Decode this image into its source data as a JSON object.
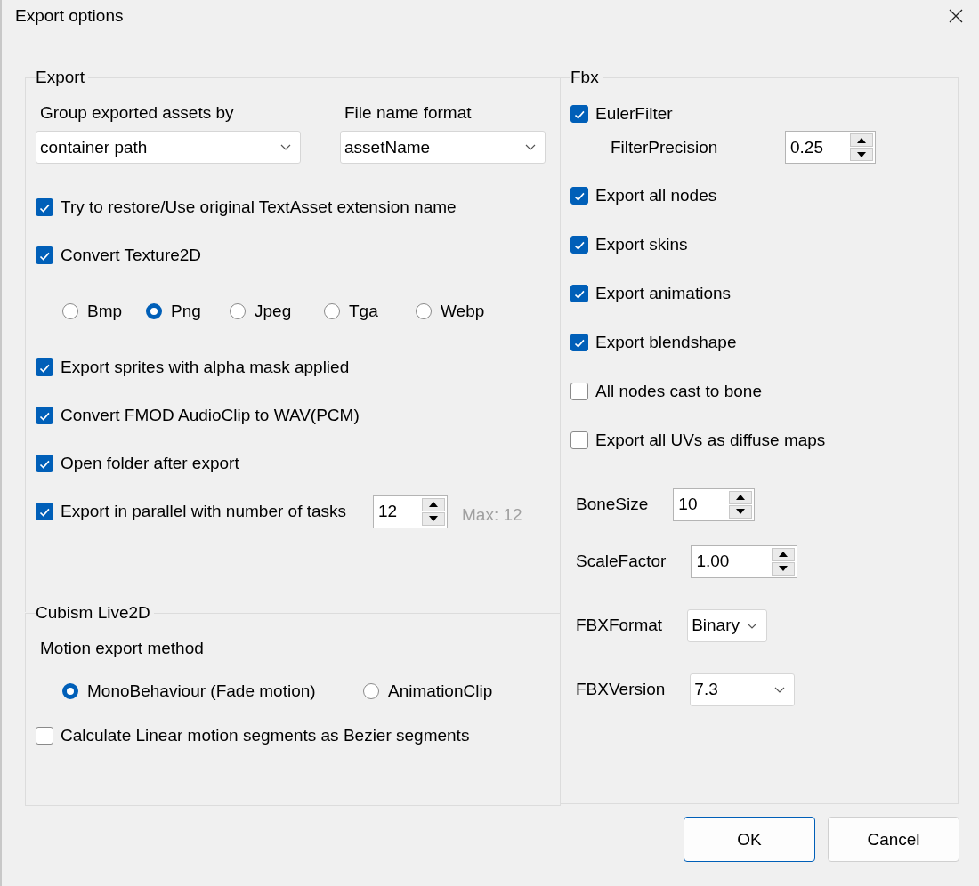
{
  "window": {
    "title": "Export options"
  },
  "export": {
    "title": "Export",
    "group_by": {
      "label": "Group exported assets by",
      "value": "container path"
    },
    "file_name_format": {
      "label": "File name format",
      "value": "assetName"
    },
    "options": [
      {
        "kind": "checkbox",
        "label": "Try to restore/Use original TextAsset extension name",
        "checked": true
      },
      {
        "kind": "checkbox",
        "label": "Convert Texture2D",
        "checked": true
      },
      {
        "kind": "radios",
        "choices": [
          {
            "label": "Bmp",
            "selected": false
          },
          {
            "label": "Png",
            "selected": true
          },
          {
            "label": "Jpeg",
            "selected": false
          },
          {
            "label": "Tga",
            "selected": false
          },
          {
            "label": "Webp",
            "selected": false
          }
        ]
      },
      {
        "kind": "checkbox",
        "label": "Export sprites with alpha mask applied",
        "checked": true
      },
      {
        "kind": "checkbox",
        "label": "Convert FMOD AudioClip to WAV(PCM)",
        "checked": true
      },
      {
        "kind": "checkbox",
        "label": "Open folder after export",
        "checked": true
      },
      {
        "kind": "spin_checkbox",
        "label": "Export in parallel with number of tasks",
        "checked": true,
        "value": "12",
        "note": "Max: 12"
      }
    ]
  },
  "cubism": {
    "title": "Cubism Live2D",
    "motion_label": "Motion export method",
    "motion_methods": [
      {
        "label": "MonoBehaviour (Fade motion)",
        "selected": true
      },
      {
        "label": "AnimationClip",
        "selected": false
      }
    ],
    "options": [
      {
        "label": "Calculate Linear motion segments as Bezier segments",
        "checked": false
      }
    ]
  },
  "fbx": {
    "title": "Fbx",
    "items": [
      {
        "kind": "checkbox",
        "label": "EulerFilter",
        "checked": true,
        "children": [
          {
            "kind": "spin",
            "label": "FilterPrecision",
            "value": "0.25"
          }
        ]
      },
      {
        "kind": "checkbox",
        "label": "Export all nodes",
        "checked": true
      },
      {
        "kind": "checkbox",
        "label": "Export skins",
        "checked": true
      },
      {
        "kind": "checkbox",
        "label": "Export animations",
        "checked": true
      },
      {
        "kind": "checkbox",
        "label": "Export blendshape",
        "checked": true
      },
      {
        "kind": "checkbox",
        "label": "All nodes cast to bone",
        "checked": false
      },
      {
        "kind": "checkbox",
        "label": "Export all UVs as diffuse maps",
        "checked": false
      },
      {
        "kind": "spin",
        "label": "BoneSize",
        "value": "10"
      },
      {
        "kind": "spin",
        "label": "ScaleFactor",
        "value": "1.00"
      },
      {
        "kind": "dropdown",
        "label": "FBXFormat",
        "value": "Binary"
      },
      {
        "kind": "dropdown",
        "label": "FBXVersion",
        "value": "7.3"
      }
    ]
  },
  "buttons": [
    {
      "label": "OK",
      "default": true
    },
    {
      "label": "Cancel",
      "default": false
    }
  ]
}
